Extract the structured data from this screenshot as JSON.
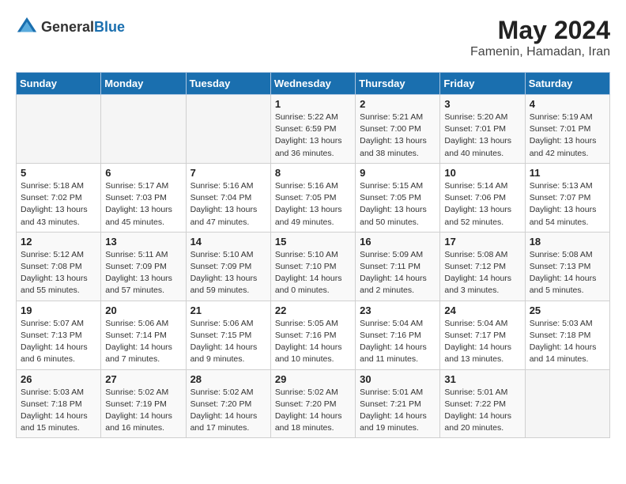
{
  "header": {
    "logo_general": "General",
    "logo_blue": "Blue",
    "month_year": "May 2024",
    "location": "Famenin, Hamadan, Iran"
  },
  "days_of_week": [
    "Sunday",
    "Monday",
    "Tuesday",
    "Wednesday",
    "Thursday",
    "Friday",
    "Saturday"
  ],
  "weeks": [
    [
      {
        "day": "",
        "sunrise": "",
        "sunset": "",
        "daylight": "",
        "empty": true
      },
      {
        "day": "",
        "sunrise": "",
        "sunset": "",
        "daylight": "",
        "empty": true
      },
      {
        "day": "",
        "sunrise": "",
        "sunset": "",
        "daylight": "",
        "empty": true
      },
      {
        "day": "1",
        "sunrise": "Sunrise: 5:22 AM",
        "sunset": "Sunset: 6:59 PM",
        "daylight": "Daylight: 13 hours and 36 minutes."
      },
      {
        "day": "2",
        "sunrise": "Sunrise: 5:21 AM",
        "sunset": "Sunset: 7:00 PM",
        "daylight": "Daylight: 13 hours and 38 minutes."
      },
      {
        "day": "3",
        "sunrise": "Sunrise: 5:20 AM",
        "sunset": "Sunset: 7:01 PM",
        "daylight": "Daylight: 13 hours and 40 minutes."
      },
      {
        "day": "4",
        "sunrise": "Sunrise: 5:19 AM",
        "sunset": "Sunset: 7:01 PM",
        "daylight": "Daylight: 13 hours and 42 minutes."
      }
    ],
    [
      {
        "day": "5",
        "sunrise": "Sunrise: 5:18 AM",
        "sunset": "Sunset: 7:02 PM",
        "daylight": "Daylight: 13 hours and 43 minutes."
      },
      {
        "day": "6",
        "sunrise": "Sunrise: 5:17 AM",
        "sunset": "Sunset: 7:03 PM",
        "daylight": "Daylight: 13 hours and 45 minutes."
      },
      {
        "day": "7",
        "sunrise": "Sunrise: 5:16 AM",
        "sunset": "Sunset: 7:04 PM",
        "daylight": "Daylight: 13 hours and 47 minutes."
      },
      {
        "day": "8",
        "sunrise": "Sunrise: 5:16 AM",
        "sunset": "Sunset: 7:05 PM",
        "daylight": "Daylight: 13 hours and 49 minutes."
      },
      {
        "day": "9",
        "sunrise": "Sunrise: 5:15 AM",
        "sunset": "Sunset: 7:05 PM",
        "daylight": "Daylight: 13 hours and 50 minutes."
      },
      {
        "day": "10",
        "sunrise": "Sunrise: 5:14 AM",
        "sunset": "Sunset: 7:06 PM",
        "daylight": "Daylight: 13 hours and 52 minutes."
      },
      {
        "day": "11",
        "sunrise": "Sunrise: 5:13 AM",
        "sunset": "Sunset: 7:07 PM",
        "daylight": "Daylight: 13 hours and 54 minutes."
      }
    ],
    [
      {
        "day": "12",
        "sunrise": "Sunrise: 5:12 AM",
        "sunset": "Sunset: 7:08 PM",
        "daylight": "Daylight: 13 hours and 55 minutes."
      },
      {
        "day": "13",
        "sunrise": "Sunrise: 5:11 AM",
        "sunset": "Sunset: 7:09 PM",
        "daylight": "Daylight: 13 hours and 57 minutes."
      },
      {
        "day": "14",
        "sunrise": "Sunrise: 5:10 AM",
        "sunset": "Sunset: 7:09 PM",
        "daylight": "Daylight: 13 hours and 59 minutes."
      },
      {
        "day": "15",
        "sunrise": "Sunrise: 5:10 AM",
        "sunset": "Sunset: 7:10 PM",
        "daylight": "Daylight: 14 hours and 0 minutes."
      },
      {
        "day": "16",
        "sunrise": "Sunrise: 5:09 AM",
        "sunset": "Sunset: 7:11 PM",
        "daylight": "Daylight: 14 hours and 2 minutes."
      },
      {
        "day": "17",
        "sunrise": "Sunrise: 5:08 AM",
        "sunset": "Sunset: 7:12 PM",
        "daylight": "Daylight: 14 hours and 3 minutes."
      },
      {
        "day": "18",
        "sunrise": "Sunrise: 5:08 AM",
        "sunset": "Sunset: 7:13 PM",
        "daylight": "Daylight: 14 hours and 5 minutes."
      }
    ],
    [
      {
        "day": "19",
        "sunrise": "Sunrise: 5:07 AM",
        "sunset": "Sunset: 7:13 PM",
        "daylight": "Daylight: 14 hours and 6 minutes."
      },
      {
        "day": "20",
        "sunrise": "Sunrise: 5:06 AM",
        "sunset": "Sunset: 7:14 PM",
        "daylight": "Daylight: 14 hours and 7 minutes."
      },
      {
        "day": "21",
        "sunrise": "Sunrise: 5:06 AM",
        "sunset": "Sunset: 7:15 PM",
        "daylight": "Daylight: 14 hours and 9 minutes."
      },
      {
        "day": "22",
        "sunrise": "Sunrise: 5:05 AM",
        "sunset": "Sunset: 7:16 PM",
        "daylight": "Daylight: 14 hours and 10 minutes."
      },
      {
        "day": "23",
        "sunrise": "Sunrise: 5:04 AM",
        "sunset": "Sunset: 7:16 PM",
        "daylight": "Daylight: 14 hours and 11 minutes."
      },
      {
        "day": "24",
        "sunrise": "Sunrise: 5:04 AM",
        "sunset": "Sunset: 7:17 PM",
        "daylight": "Daylight: 14 hours and 13 minutes."
      },
      {
        "day": "25",
        "sunrise": "Sunrise: 5:03 AM",
        "sunset": "Sunset: 7:18 PM",
        "daylight": "Daylight: 14 hours and 14 minutes."
      }
    ],
    [
      {
        "day": "26",
        "sunrise": "Sunrise: 5:03 AM",
        "sunset": "Sunset: 7:18 PM",
        "daylight": "Daylight: 14 hours and 15 minutes."
      },
      {
        "day": "27",
        "sunrise": "Sunrise: 5:02 AM",
        "sunset": "Sunset: 7:19 PM",
        "daylight": "Daylight: 14 hours and 16 minutes."
      },
      {
        "day": "28",
        "sunrise": "Sunrise: 5:02 AM",
        "sunset": "Sunset: 7:20 PM",
        "daylight": "Daylight: 14 hours and 17 minutes."
      },
      {
        "day": "29",
        "sunrise": "Sunrise: 5:02 AM",
        "sunset": "Sunset: 7:20 PM",
        "daylight": "Daylight: 14 hours and 18 minutes."
      },
      {
        "day": "30",
        "sunrise": "Sunrise: 5:01 AM",
        "sunset": "Sunset: 7:21 PM",
        "daylight": "Daylight: 14 hours and 19 minutes."
      },
      {
        "day": "31",
        "sunrise": "Sunrise: 5:01 AM",
        "sunset": "Sunset: 7:22 PM",
        "daylight": "Daylight: 14 hours and 20 minutes."
      },
      {
        "day": "",
        "sunrise": "",
        "sunset": "",
        "daylight": "",
        "empty": true
      }
    ]
  ]
}
